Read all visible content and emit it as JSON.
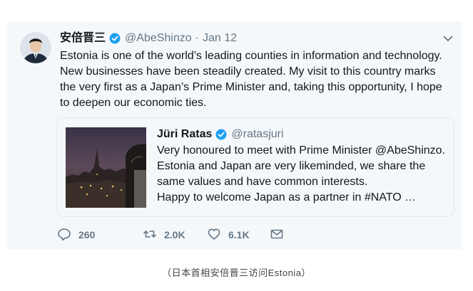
{
  "tweet": {
    "display_name": "安倍晋三",
    "handle": "@AbeShinzo",
    "separator": "·",
    "date": "Jan 12",
    "text": "Estonia is one of the world’s leading counties in information and technology. New businesses have been steadily created. My visit to this country marks the very first as a Japan’s Prime Minister and, taking this opportunity, I hope to deepen our economic ties."
  },
  "quote": {
    "display_name": "Jüri Ratas",
    "handle": "@ratasjuri",
    "lines": [
      "Very honoured to meet with Prime Minister @AbeShinzo.",
      "Estonia and Japan are very likeminded, we share the same values and have common interests.",
      "Happy to welcome Japan as a partner in #NATO …"
    ]
  },
  "actions": {
    "reply_count": "260",
    "retweet_count": "2.0K",
    "like_count": "6.1K"
  },
  "icons": {
    "verified": "verified-badge-icon",
    "chevron": "chevron-down-icon",
    "reply": "reply-icon",
    "retweet": "retweet-icon",
    "like": "heart-icon",
    "dm": "envelope-icon"
  },
  "colors": {
    "verified": "#1da1f2",
    "muted": "#657786",
    "text": "#14171a",
    "background": "#f5f8fa"
  },
  "caption": "（日本首相安倍晋三访问Estonia）"
}
